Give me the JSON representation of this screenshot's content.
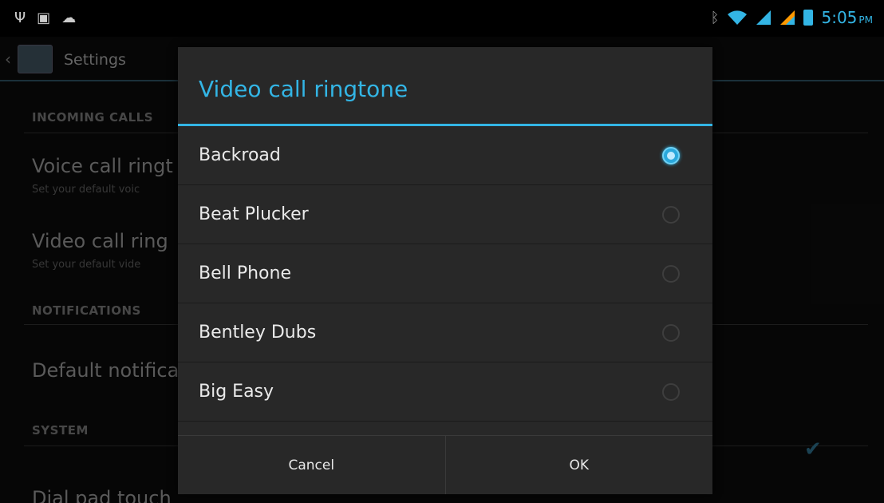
{
  "status_bar": {
    "left_icons": [
      "usb-icon",
      "image-notification-icon",
      "android-debug-icon"
    ],
    "time": "5:05",
    "ampm": "PM",
    "accent_color": "#33b5e5"
  },
  "background": {
    "app_title": "Settings",
    "sections": {
      "incoming_calls": "INCOMING CALLS",
      "notifications": "NOTIFICATIONS",
      "system": "SYSTEM"
    },
    "prefs": {
      "voice_title": "Voice call ringt",
      "voice_sub": "Set your default voic",
      "video_title": "Video call ring",
      "video_sub": "Set your default vide",
      "default_notif_title": "Default notifica",
      "dialpad_title": "Dial pad touch"
    }
  },
  "dialog": {
    "title": "Video call ringtone",
    "items": [
      {
        "label": "Backroad",
        "selected": true
      },
      {
        "label": "Beat Plucker",
        "selected": false
      },
      {
        "label": "Bell Phone",
        "selected": false
      },
      {
        "label": "Bentley Dubs",
        "selected": false
      },
      {
        "label": "Big Easy",
        "selected": false
      }
    ],
    "cancel_label": "Cancel",
    "ok_label": "OK"
  }
}
